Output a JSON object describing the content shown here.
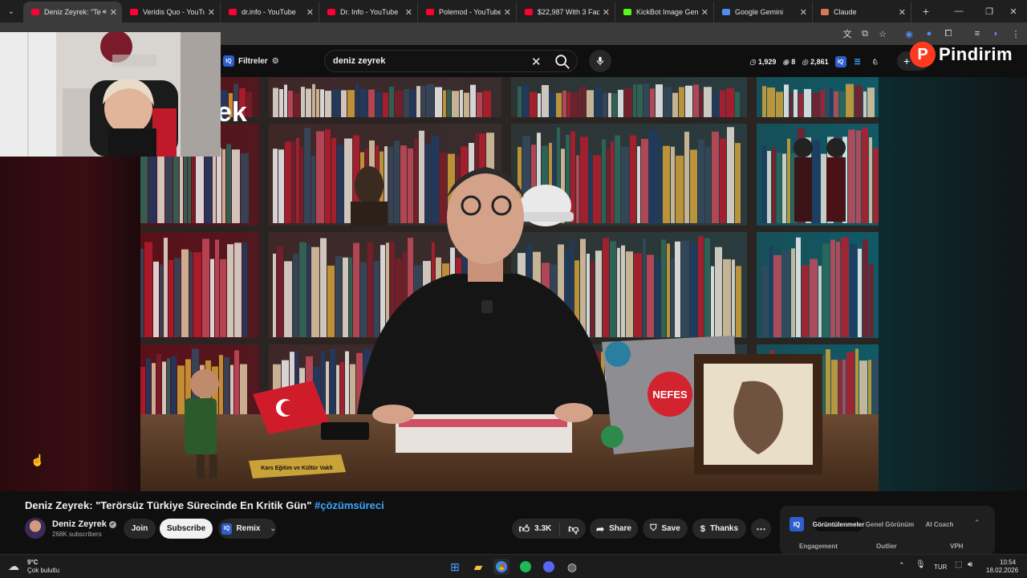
{
  "browser": {
    "tabs": [
      {
        "title": "Deniz Zeyrek: \"Te",
        "favicon_color": "#ff0033",
        "active": true,
        "audio": true
      },
      {
        "title": "Veridis Quo - YouTube",
        "favicon_color": "#ff0033"
      },
      {
        "title": "dr.info - YouTube",
        "favicon_color": "#ff0033"
      },
      {
        "title": "Dr. Info - YouTube",
        "favicon_color": "#ff0033"
      },
      {
        "title": "Polemod - YouTube",
        "favicon_color": "#ff0033"
      },
      {
        "title": "$22,987 With 3 Facel",
        "favicon_color": "#ff0033"
      },
      {
        "title": "KickBot Image Gener",
        "favicon_color": "#53fc18"
      },
      {
        "title": "Google Gemini",
        "favicon_color": "#4f8df5"
      },
      {
        "title": "Claude",
        "favicon_color": "#d97757"
      }
    ]
  },
  "youtube": {
    "filters_label": "Filtreler",
    "search_value": "deniz zeyrek",
    "stats": {
      "views": "1,929",
      "count": "8",
      "watching": "2,861"
    },
    "overlay_brand": "Pindirim"
  },
  "video": {
    "title_main": "Deniz Zeyrek: \"Terörsüz Türkiye Sürecinde En Kritik Gün\" ",
    "title_hashtag": "#çözümsüreci",
    "laptop_sticker": "NEFES",
    "sign_text": "Kars Eğitim ve Kültür Vakfı",
    "poster_letters": "ek"
  },
  "channel": {
    "name": "Deniz Zeyrek",
    "subscribers": "268K subscribers",
    "join_label": "Join",
    "subscribe_label": "Subscribe",
    "remix_label": "Remix"
  },
  "actions": {
    "likes": "3.3K",
    "share_label": "Share",
    "save_label": "Save",
    "thanks_label": "Thanks"
  },
  "side_panel": {
    "tabs": [
      "Görüntülenmeler",
      "Genel Görünüm",
      "AI Coach"
    ],
    "columns": [
      "Engagement",
      "Outlier",
      "VPH"
    ]
  },
  "taskbar": {
    "weather_temp": "9°C",
    "weather_desc": "Çok bulutlu",
    "language": "TUR",
    "time": "10:54",
    "date": "18.02.2026"
  }
}
